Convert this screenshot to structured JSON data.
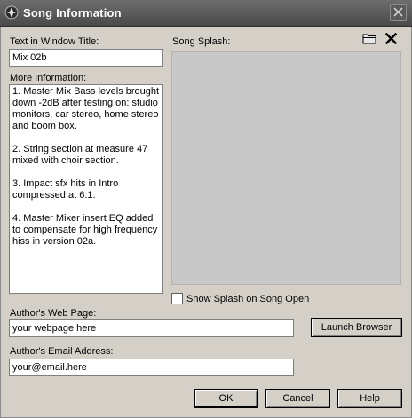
{
  "window": {
    "title": "Song Information"
  },
  "title_text": {
    "label": "Text in Window Title:",
    "value": "Mix 02b"
  },
  "splash": {
    "label": "Song Splash:",
    "show_on_open_label": "Show Splash on Song Open",
    "show_on_open_checked": false
  },
  "more_info": {
    "label": "More Information:",
    "paragraphs": [
      "1. Master Mix Bass levels brought down -2dB after testing on: studio monitors, car stereo, home stereo and boom box.",
      "2. String section at measure 47 mixed with choir section.",
      "3. Impact sfx hits in Intro compressed at 6:1.",
      "4. Master Mixer insert EQ added to compensate for high frequency hiss in version 02a."
    ]
  },
  "web_page": {
    "label": "Author's Web Page:",
    "value": "your webpage here",
    "launch_label": "Launch Browser"
  },
  "email": {
    "label": "Author's Email Address:",
    "value": "your@email.here"
  },
  "buttons": {
    "ok": "OK",
    "cancel": "Cancel",
    "help": "Help"
  },
  "icons": {
    "app": "cubase-logo-icon",
    "close": "close-icon",
    "open": "folder-open-icon",
    "remove": "delete-x-icon"
  }
}
